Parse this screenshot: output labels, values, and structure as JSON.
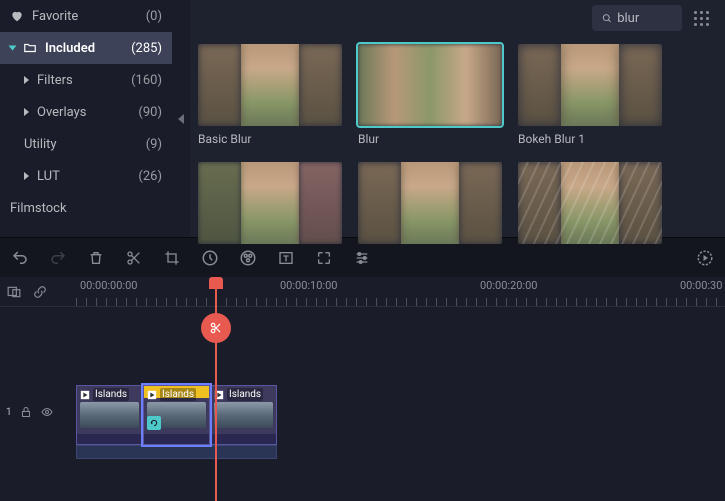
{
  "sidebar": {
    "items": [
      {
        "label": "Favorite",
        "count": "(0)"
      },
      {
        "label": "Included",
        "count": "(285)"
      },
      {
        "label": "Filters",
        "count": "(160)"
      },
      {
        "label": "Overlays",
        "count": "(90)"
      },
      {
        "label": "Utility",
        "count": "(9)"
      },
      {
        "label": "LUT",
        "count": "(26)"
      },
      {
        "label": "Filmstock",
        "count": ""
      }
    ]
  },
  "search": {
    "value": "blur"
  },
  "effects": [
    {
      "label": "Basic Blur"
    },
    {
      "label": "Blur"
    },
    {
      "label": "Bokeh Blur 1"
    },
    {
      "label": ""
    },
    {
      "label": ""
    },
    {
      "label": ""
    }
  ],
  "timeline": {
    "marks": [
      "00:00:00:00",
      "00:00:10:00",
      "00:00:20:00",
      "00:00:30"
    ],
    "track_index": "1",
    "clips": [
      {
        "name": "Islands"
      },
      {
        "name": "Islands"
      },
      {
        "name": "Islands"
      }
    ]
  }
}
